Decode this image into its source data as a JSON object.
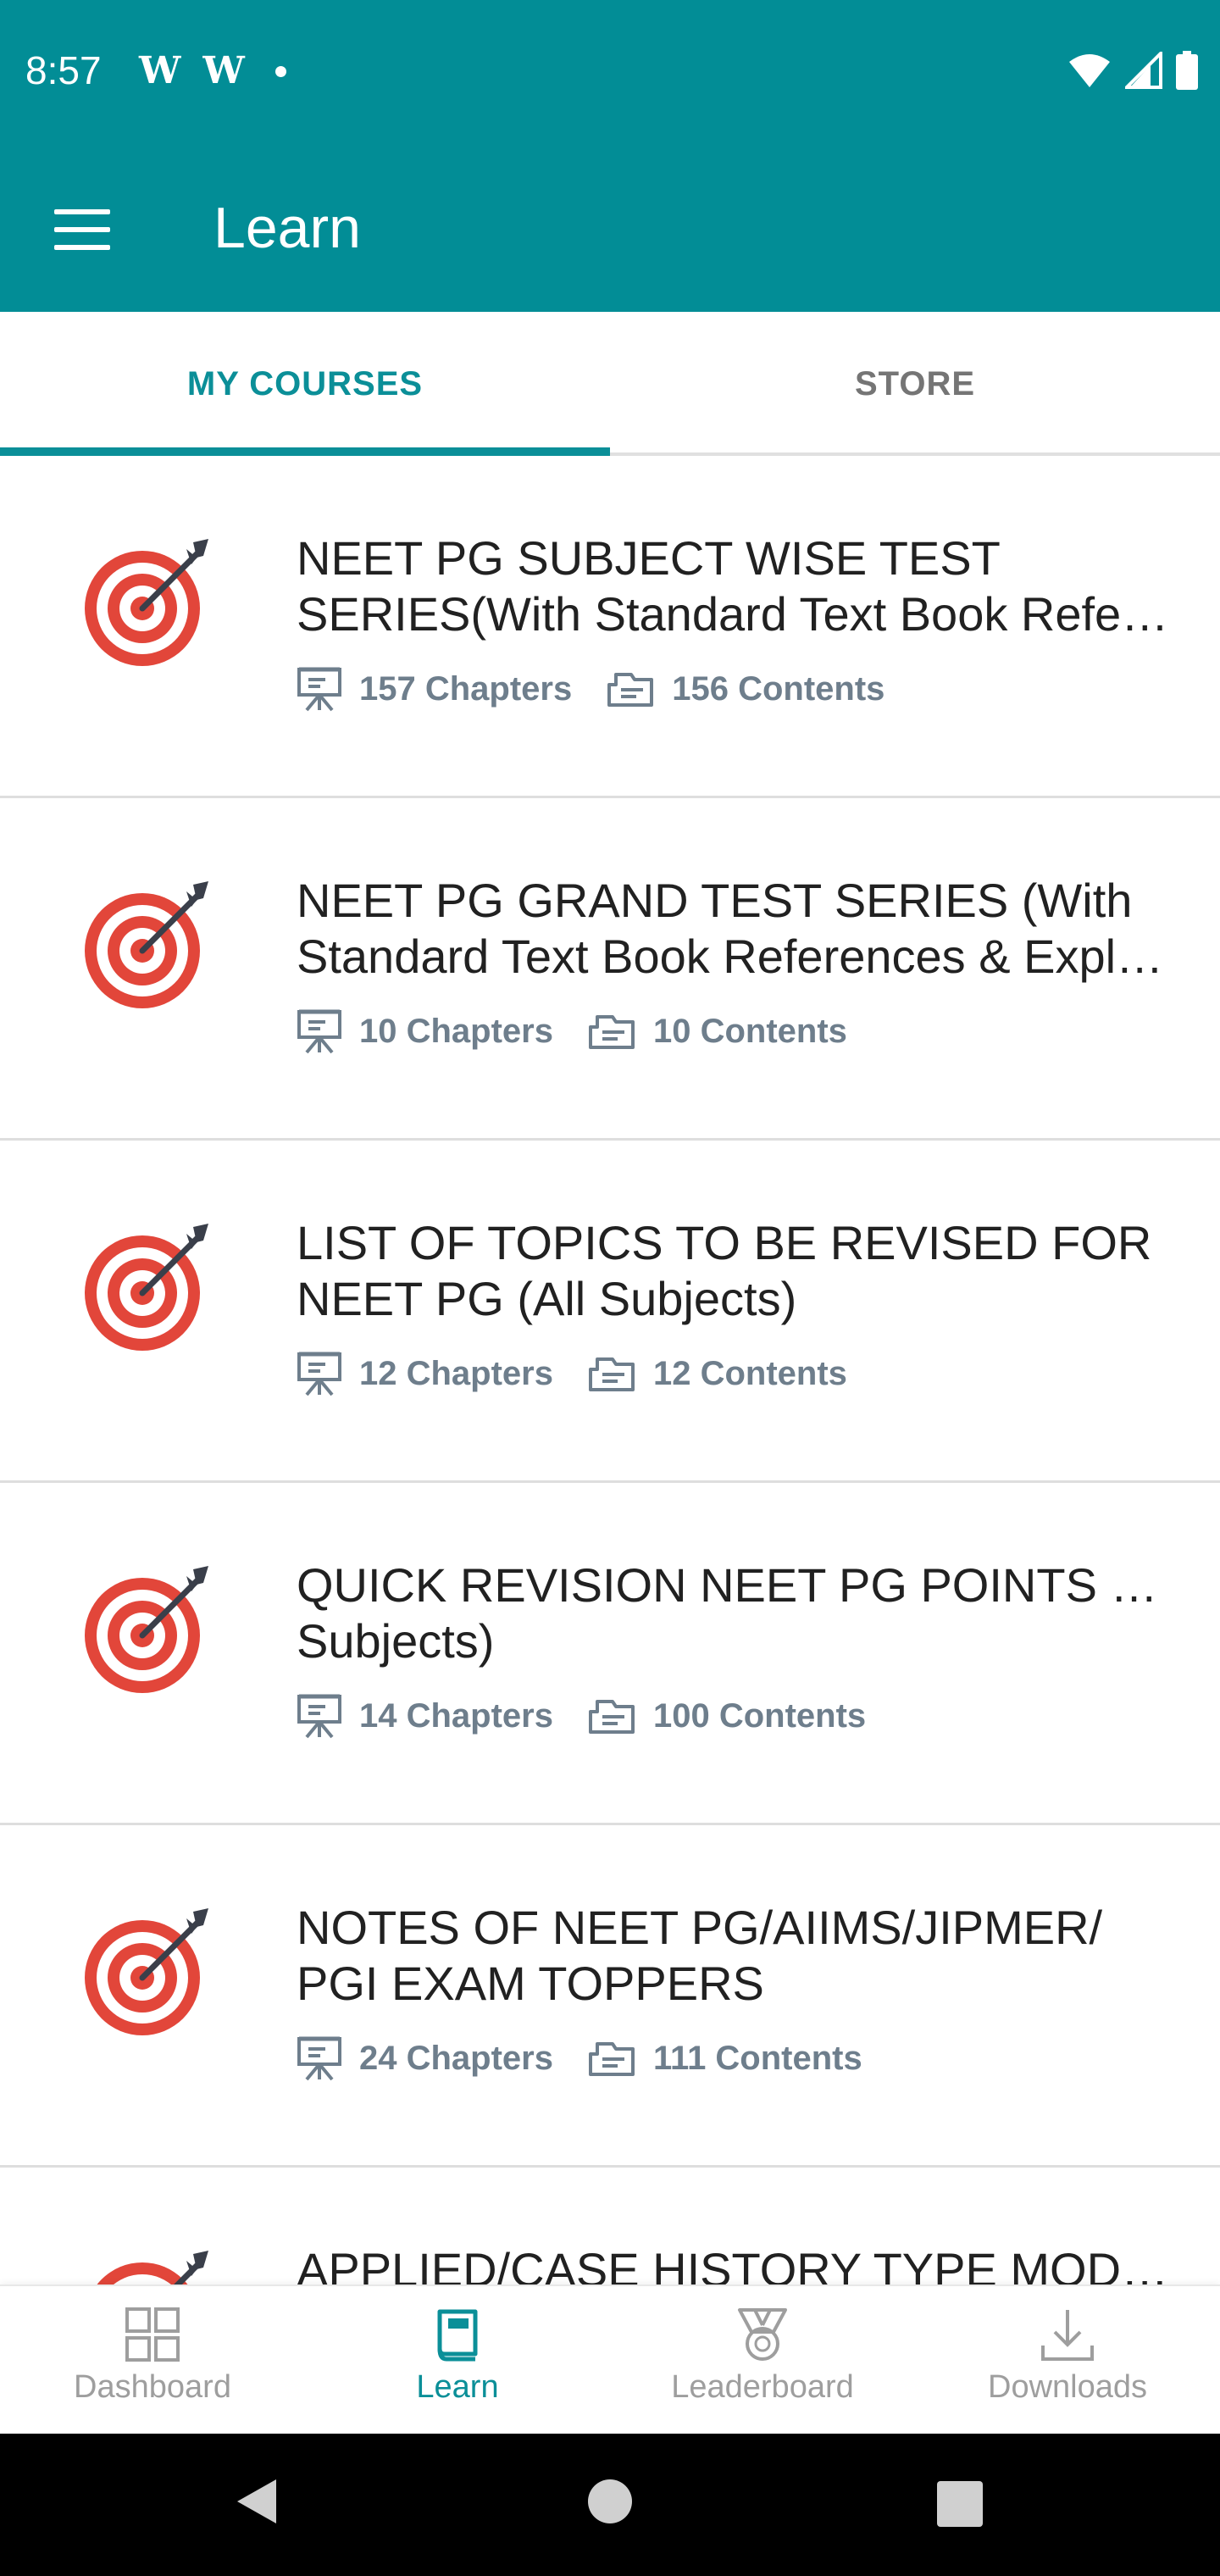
{
  "status_bar": {
    "time": "8:57",
    "left_icons": [
      "W",
      "W"
    ],
    "right_icons": [
      "wifi-icon",
      "signal-icon",
      "battery-icon"
    ]
  },
  "app_bar": {
    "title": "Learn",
    "menu_icon": "hamburger-menu-icon"
  },
  "tabs": [
    {
      "label": "MY COURSES",
      "active": true
    },
    {
      "label": "STORE",
      "active": false
    }
  ],
  "courses": [
    {
      "title_line1": "NEET PG SUBJECT WISE TEST",
      "title_line2": "SERIES(With Standard Text Book References & Explanations)",
      "chapters": "157 Chapters",
      "contents": "156 Contents"
    },
    {
      "title_line1": "NEET PG GRAND TEST SERIES (With",
      "title_line2": "Standard Text Book References & Explanations)",
      "chapters": "10 Chapters",
      "contents": "10 Contents"
    },
    {
      "title_line1": "LIST OF TOPICS TO BE REVISED FOR",
      "title_line2": "NEET PG (All Subjects)",
      "chapters": "12 Chapters",
      "contents": "12 Contents"
    },
    {
      "title_line1": "QUICK REVISION NEET PG POINTS (All",
      "title_line2": "Subjects)",
      "chapters": "14 Chapters",
      "contents": "100 Contents"
    },
    {
      "title_line1": "NOTES OF NEET PG/AIIMS/JIPMER/",
      "title_line2": "PGI EXAM TOPPERS",
      "chapters": "24 Chapters",
      "contents": "111 Contents"
    },
    {
      "title_line1": "APPLIED/CASE HISTORY TYPE MODEL",
      "title_line2": "",
      "chapters": "",
      "contents": ""
    }
  ],
  "bottom_nav": [
    {
      "label": "Dashboard",
      "icon": "dashboard-icon",
      "active": false
    },
    {
      "label": "Learn",
      "icon": "book-icon",
      "active": true
    },
    {
      "label": "Leaderboard",
      "icon": "medal-icon",
      "active": false
    },
    {
      "label": "Downloads",
      "icon": "download-icon",
      "active": false
    }
  ],
  "colors": {
    "primary": "#028d96",
    "accent": "#0b8f98",
    "target_red": "#e2463a",
    "meta_gray": "#6e7e8c",
    "inactive_gray": "#9e9e9e"
  }
}
